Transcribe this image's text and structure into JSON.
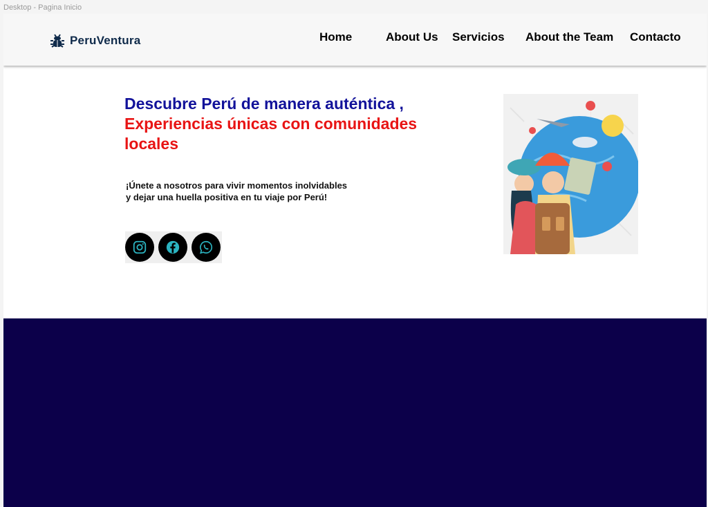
{
  "frame": {
    "label": "Desktop - Pagina Inicio"
  },
  "navbar": {
    "logo_text": "PeruVentura",
    "links": [
      "Home",
      "About Us",
      "Servicios",
      "About the Team",
      "Contacto"
    ]
  },
  "hero": {
    "title_line1": "Descubre Perú de manera auténtica ,",
    "title_line2": "Experiencias únicas con comunidades locales",
    "subtitle_line1": "¡Únete a nosotros para vivir momentos inolvidables",
    "subtitle_line2": "y dejar una huella positiva en tu viaje por Perú!"
  },
  "socials": [
    {
      "icon": "instagram-icon"
    },
    {
      "icon": "facebook-icon"
    },
    {
      "icon": "whatsapp-icon"
    }
  ],
  "colors": {
    "title_primary": "#12129a",
    "title_accent": "#e81414",
    "social_icon": "#2bb3c0",
    "dark_section": "#0c004a"
  }
}
